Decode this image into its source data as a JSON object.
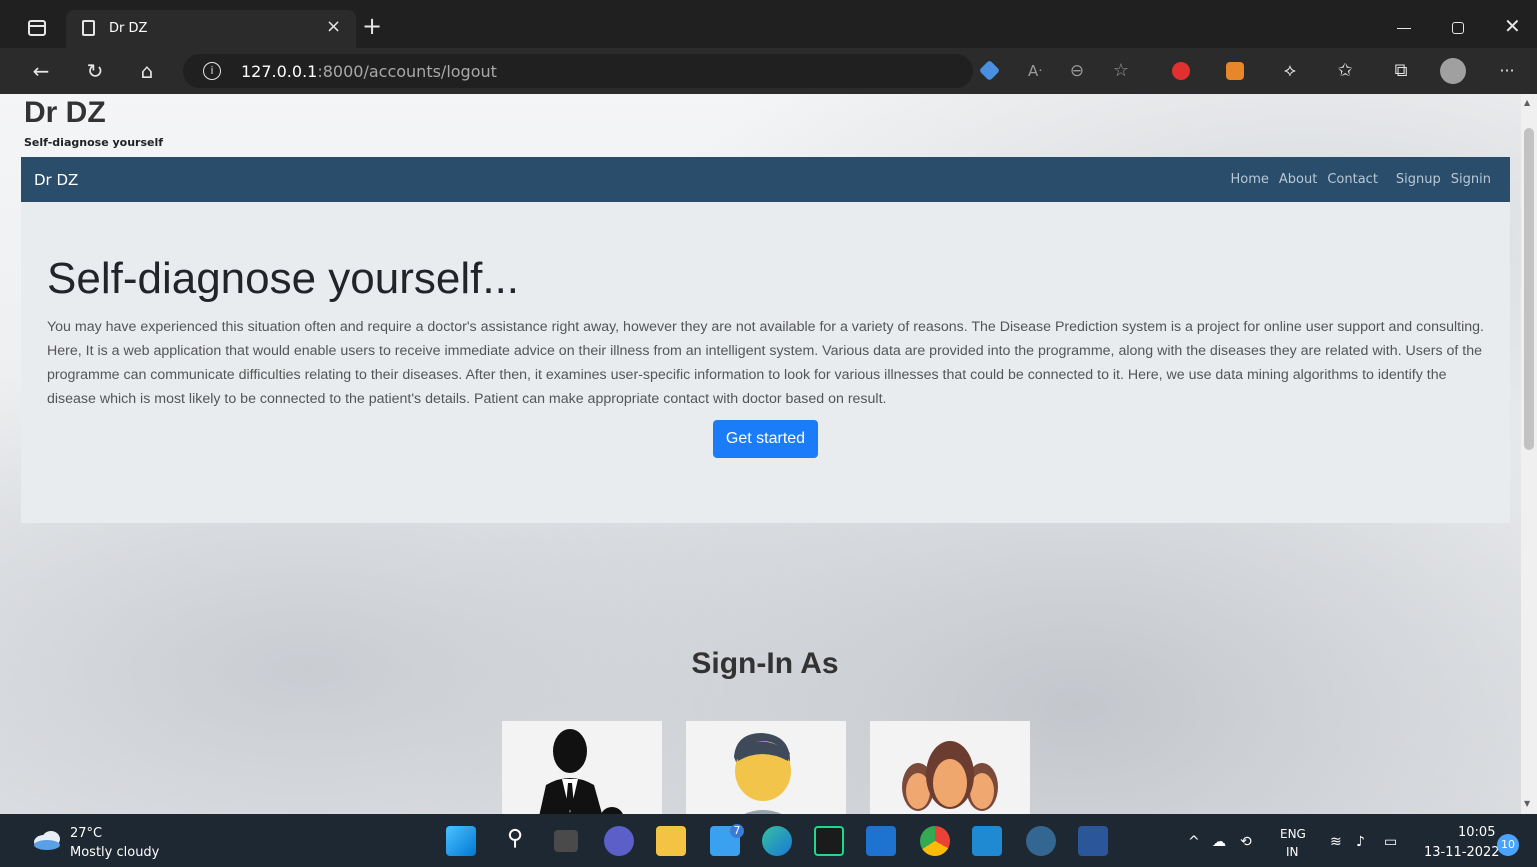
{
  "browser": {
    "tab_title": "Dr DZ",
    "tab_close": "×",
    "new_tab": "+",
    "address_host": "127.0.0.1",
    "address_path": ":8000/accounts/logout",
    "info_icon": "i"
  },
  "page": {
    "site_title": "Dr DZ",
    "site_subtitle": "Self-diagnose yourself",
    "navbar": {
      "brand": "Dr DZ",
      "links": [
        "Home",
        "About",
        "Contact",
        "Signup",
        "Signin"
      ]
    },
    "hero": {
      "title": "Self-diagnose yourself...",
      "body": "You may have experienced this situation often and require a doctor's assistance right away, however they are not available for a variety of reasons. The Disease Prediction system is a project for online user support and consulting. Here, It is a web application that would enable users to receive immediate advice on their illness from an intelligent system. Various data are provided into the programme, along with the diseases they are related with. Users of the programme can communicate difficulties relating to their diseases. After then, it examines user-specific information to look for various illnesses that could be connected to it. Here, we use data mining algorithms to identify the disease which is most likely to be connected to the patient's details. Patient can make appropriate contact with doctor based on result.",
      "cta_label": "Get started"
    },
    "signin_heading": "Sign-In As"
  },
  "taskbar": {
    "weather_temp": "27°C",
    "weather_desc": "Mostly cloudy",
    "mail_badge": "7",
    "lang_top": "ENG",
    "lang_bottom": "IN",
    "time": "10:05",
    "date": "13-11-2022",
    "notification_count": "10"
  },
  "colors": {
    "navbar": "#2a4d6b",
    "cta": "#1a7cf8",
    "jumbotron": "#e9ecef"
  }
}
